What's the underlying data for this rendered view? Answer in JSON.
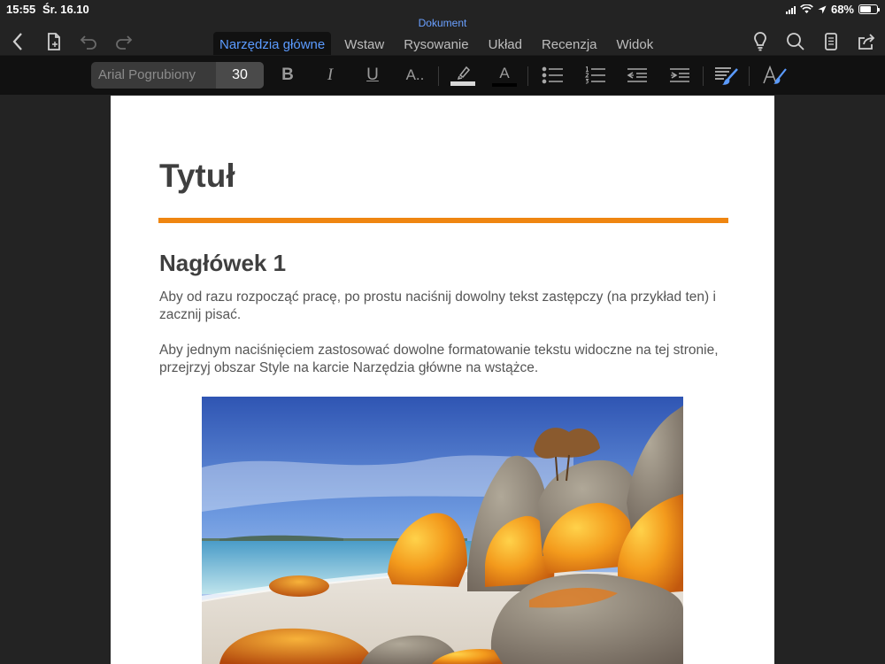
{
  "status": {
    "time": "15:55",
    "date": "Śr. 16.10",
    "battery_percent": "68%",
    "battery_level": 0.68
  },
  "document": {
    "name": "Dokument"
  },
  "toolbar": {
    "icons": [
      "back-icon",
      "file-icon",
      "undo-icon",
      "redo-icon",
      "lightbulb-icon",
      "search-icon",
      "reading-view-icon",
      "share-icon"
    ]
  },
  "tabs": [
    {
      "label": "Narzędzia główne",
      "active": true
    },
    {
      "label": "Wstaw"
    },
    {
      "label": "Rysowanie"
    },
    {
      "label": "Układ"
    },
    {
      "label": "Recenzja"
    },
    {
      "label": "Widok"
    }
  ],
  "ribbon": {
    "font_name": "Arial Pogrubiony",
    "font_size": "30",
    "bold": "B",
    "italic": "I",
    "underline": "U",
    "font_options": "A..",
    "font_color": "A",
    "accent_color": "#ef8611",
    "active_color": "#5b9bff"
  },
  "content": {
    "title": "Tytuł",
    "heading1": "Nagłówek 1",
    "paragraph1": "Aby od razu rozpocząć pracę, po prostu naciśnij dowolny tekst zastępczy (na przykład ten) i zacznij pisać.",
    "paragraph2": "Aby jednym naciśnięciem zastosować dowolne formatowanie tekstu widoczne na tej stronie, przejrzyj obszar Style na karcie Narzędzia główne na wstążce."
  }
}
